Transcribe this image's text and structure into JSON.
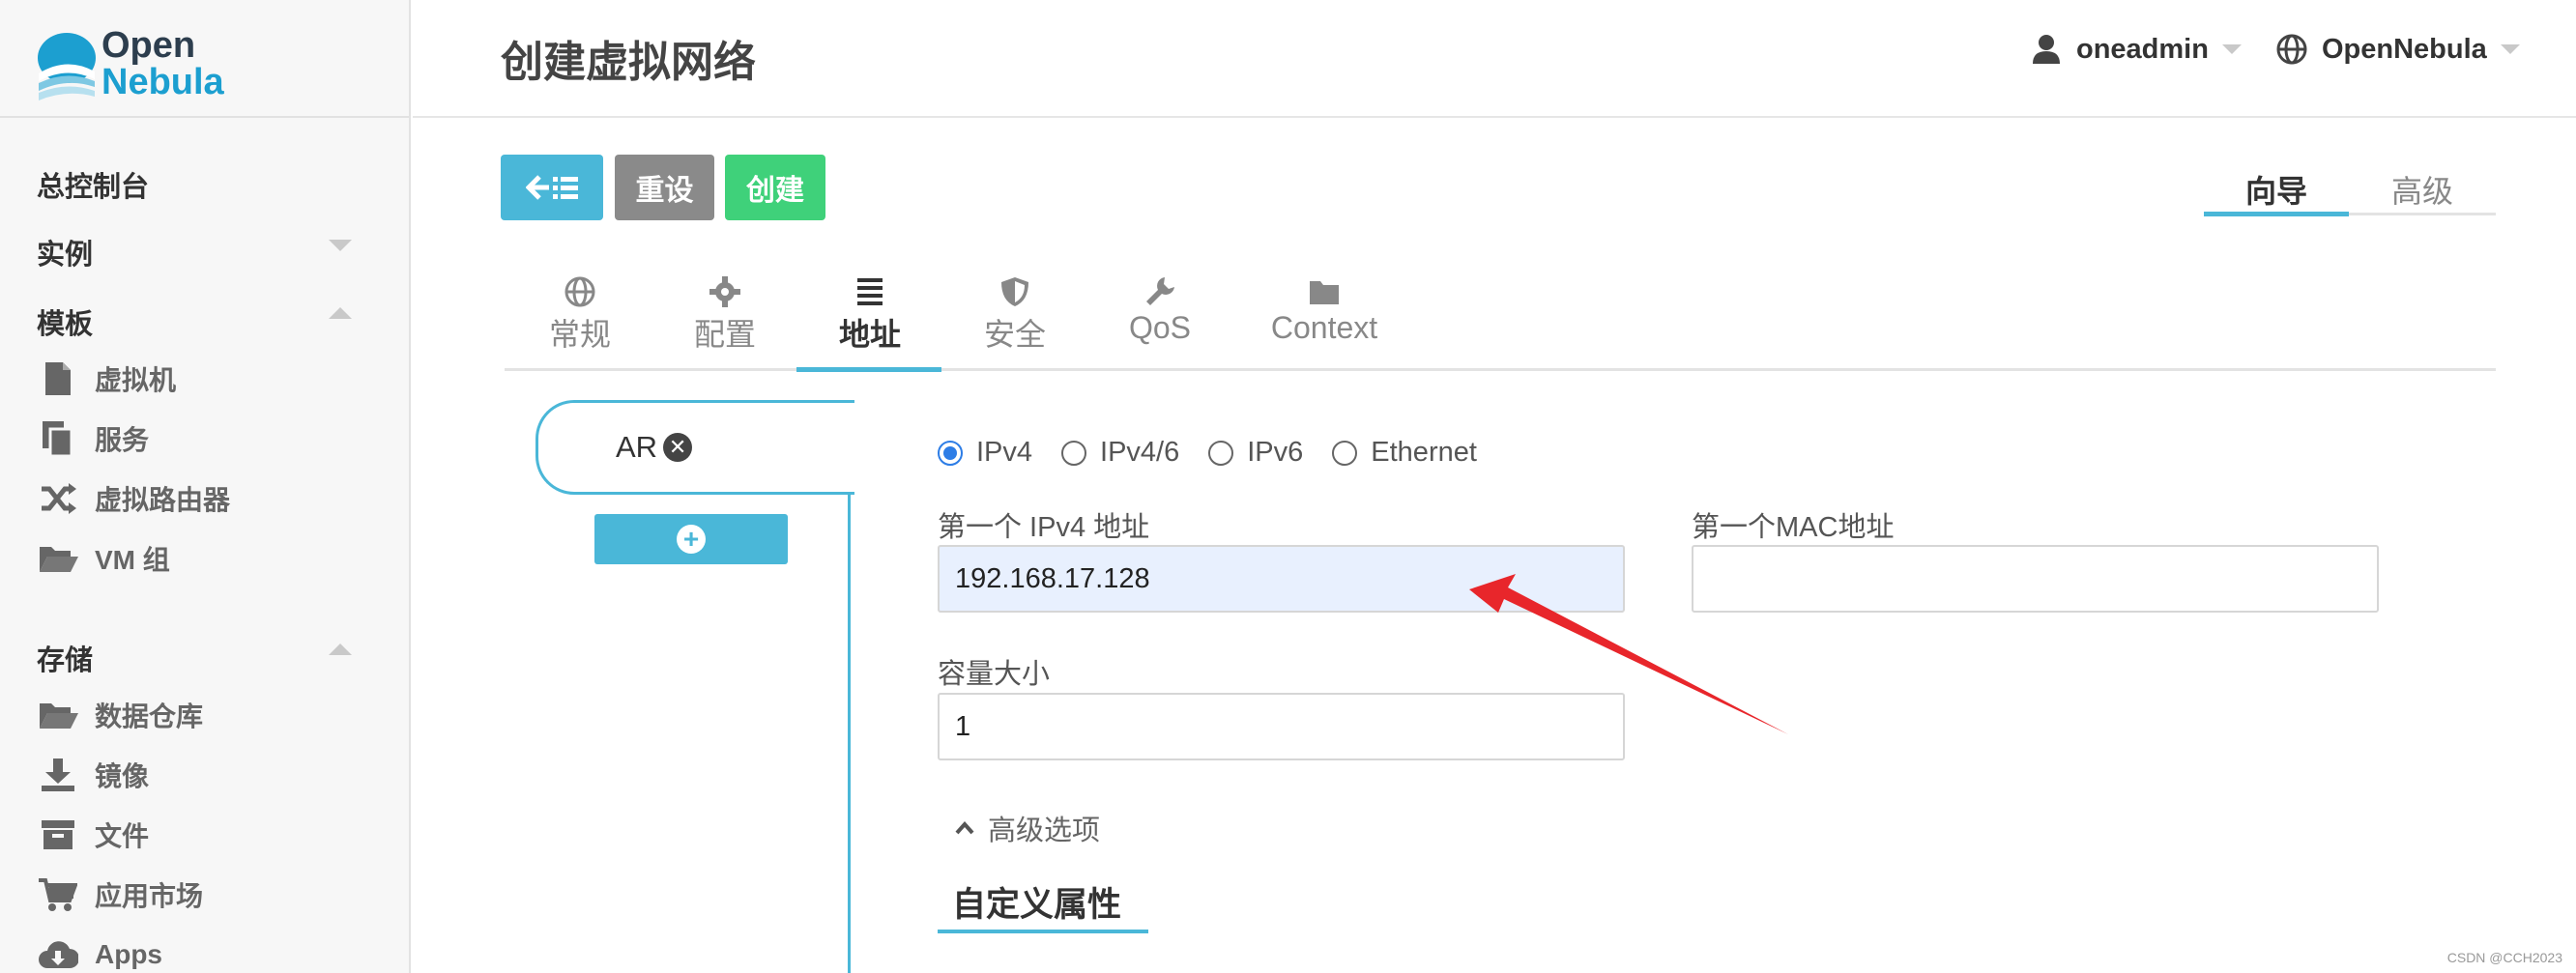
{
  "brand": {
    "line1": "Open",
    "line2": "Nebula"
  },
  "sidebar": {
    "dashboard": "总控制台",
    "instances": "实例",
    "templates": "模板",
    "template_items": [
      {
        "label": "虚拟机",
        "icon": "file-icon"
      },
      {
        "label": "服务",
        "icon": "copy-icon"
      },
      {
        "label": "虚拟路由器",
        "icon": "shuffle-icon"
      },
      {
        "label": "VM 组",
        "icon": "folder-open-icon"
      }
    ],
    "storage": "存储",
    "storage_items": [
      {
        "label": "数据仓库",
        "icon": "folder-open-icon"
      },
      {
        "label": "镜像",
        "icon": "download-icon"
      },
      {
        "label": "文件",
        "icon": "archive-icon"
      },
      {
        "label": "应用市场",
        "icon": "cart-icon"
      },
      {
        "label": "Apps",
        "icon": "cloud-download-icon"
      }
    ]
  },
  "header": {
    "title": "创建虚拟网络",
    "user": "oneadmin",
    "zone": "OpenNebula"
  },
  "toolbar": {
    "reset": "重设",
    "create": "创建"
  },
  "mode_tabs": {
    "wizard": "向导",
    "advanced": "高级"
  },
  "section_tabs": [
    {
      "label": "常规",
      "icon": "globe-icon"
    },
    {
      "label": "配置",
      "icon": "gear-icon"
    },
    {
      "label": "地址",
      "icon": "list-icon"
    },
    {
      "label": "安全",
      "icon": "shield-icon"
    },
    {
      "label": "QoS",
      "icon": "wrench-icon"
    },
    {
      "label": "Context",
      "icon": "folder-icon"
    }
  ],
  "ar": {
    "label": "AR"
  },
  "address_type": {
    "options": [
      "IPv4",
      "IPv4/6",
      "IPv6",
      "Ethernet"
    ],
    "selected": "IPv4"
  },
  "form": {
    "first_ipv4_label": "第一个 IPv4 地址",
    "first_ipv4_value": "192.168.17.128",
    "first_mac_label": "第一个MAC地址",
    "first_mac_value": "",
    "size_label": "容量大小",
    "size_value": "1",
    "advanced_options": "高级选项",
    "custom_attributes": "自定义属性"
  },
  "colors": {
    "accent": "#4ab7d8",
    "create": "#3fd17a",
    "reset": "#8a8a8a",
    "annotation_arrow": "#e8262b"
  },
  "watermark": "CSDN @CCH2023"
}
